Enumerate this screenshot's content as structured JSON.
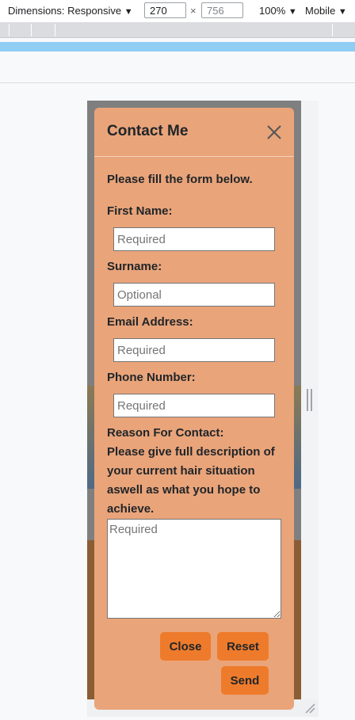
{
  "devtools": {
    "dimensions_label": "Dimensions: Responsive",
    "dropdown_arrow": "▼",
    "width_value": "270",
    "times": "×",
    "height_placeholder": "756",
    "zoom_label": "100%",
    "device_mode_label": "Mobile"
  },
  "modal": {
    "title": "Contact Me",
    "intro": "Please fill the form below.",
    "fields": [
      {
        "label": "First Name:",
        "placeholder": "Required"
      },
      {
        "label": "Surname:",
        "placeholder": "Optional"
      },
      {
        "label": "Email Address:",
        "placeholder": "Required"
      },
      {
        "label": "Phone Number:",
        "placeholder": "Required"
      }
    ],
    "reason_label": "Reason For Contact:",
    "reason_description": "Please give full description of your current hair situation aswell as what you hope to achieve.",
    "reason_placeholder": "Required",
    "buttons": {
      "close": "Close",
      "reset": "Reset",
      "send": "Send"
    }
  },
  "colors": {
    "modal_background": "#e9a47a",
    "button_background": "#ee7b2b",
    "media_query_bar": "#8fcdf5"
  },
  "icons": {
    "close": "close-x-icon",
    "dropdown": "triangle-down-icon",
    "resize": "resize-handle-icon",
    "corner": "corner-resize-icon"
  }
}
